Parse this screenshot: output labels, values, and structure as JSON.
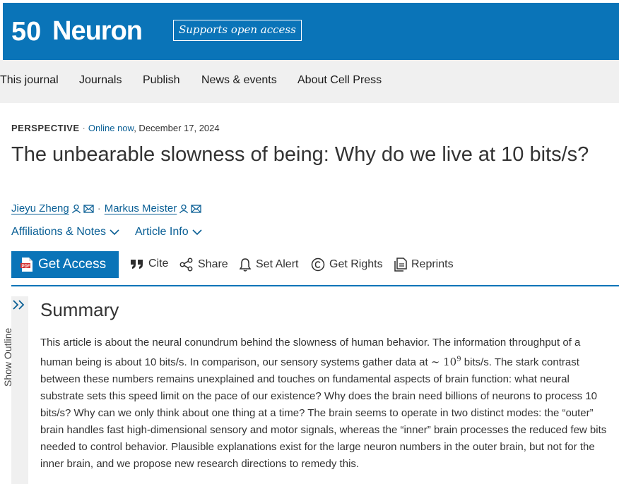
{
  "header": {
    "logo_text": "Neuron",
    "logo_mark": "50",
    "oa_badge": "Supports open access",
    "brand_color": "#0a74b8"
  },
  "nav": {
    "items": [
      "This journal",
      "Journals",
      "Publish",
      "News & events",
      "About Cell Press"
    ]
  },
  "article": {
    "type": "PERSPECTIVE",
    "online": "Online now",
    "date": ", December 17, 2024",
    "title": "The unbearable slowness of being: Why do we live at 10 bits/s?",
    "authors": [
      "Jieyu Zheng",
      "Markus Meister"
    ],
    "author_sep": "·",
    "links": [
      "Affiliations & Notes",
      "Article Info"
    ]
  },
  "toolbar": {
    "get_access": "Get Access",
    "cite": "Cite",
    "share": "Share",
    "set_alert": "Set Alert",
    "get_rights": "Get Rights",
    "reprints": "Reprints"
  },
  "rail": {
    "label": "Show Outline"
  },
  "summary": {
    "heading": "Summary",
    "text_before": "This article is about the neural conundrum behind the slowness of human behavior. The information throughput of a human being is about 10 bits/s. In comparison, our sensory systems gather data at ",
    "math": "∼ 10",
    "math_exp": "9",
    "text_after": " bits/s. The stark contrast between these numbers remains unexplained and touches on fundamental aspects of brain function: what neural substrate sets this speed limit on the pace of our existence? Why does the brain need billions of neurons to process 10 bits/s? Why can we only think about one thing at a time? The brain seems to operate in two distinct modes: the “outer” brain handles fast high-dimensional sensory and motor signals, whereas the “inner” brain processes the reduced few bits needed to control behavior. Plausible explanations exist for the large neuron numbers in the outer brain, but not for the inner brain, and we propose new research directions to remedy this."
  }
}
